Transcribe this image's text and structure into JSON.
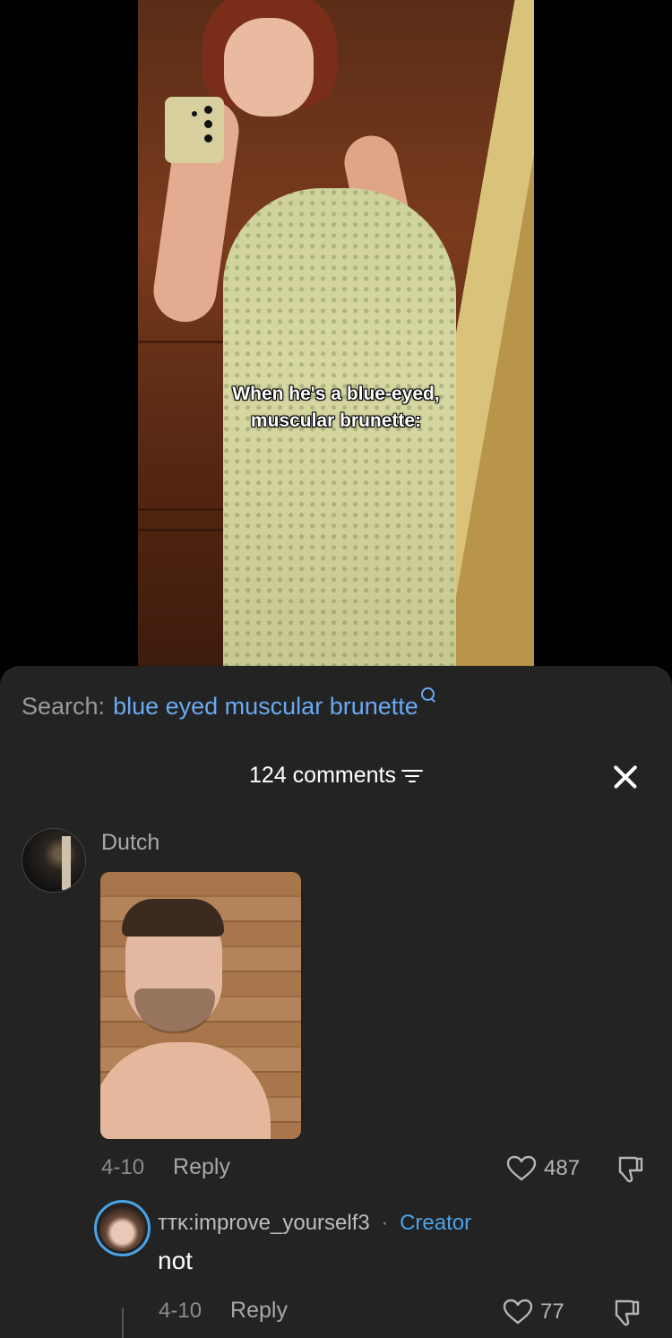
{
  "video": {
    "caption_line1": "When he's a blue-eyed,",
    "caption_line2": "muscular brunette:"
  },
  "search": {
    "prefix": "Search:",
    "term": "blue eyed muscular brunette",
    "icon": "search-icon"
  },
  "comments": {
    "count_label": "124 comments",
    "filter_icon": "filter-icon",
    "close_icon": "close-icon"
  },
  "comment": {
    "author": "Dutch",
    "date": "4-10",
    "reply_label": "Reply",
    "likes": "487"
  },
  "reply": {
    "author": "ᴛᴛᴋ:improve_yourself3",
    "separator": "·",
    "badge": "Creator",
    "text": "not",
    "date": "4-10",
    "reply_label": "Reply",
    "likes": "77"
  },
  "colors": {
    "sheet_bg": "#232323",
    "search_link": "#6aa9f2",
    "creator_accent": "#4aa3e8"
  }
}
